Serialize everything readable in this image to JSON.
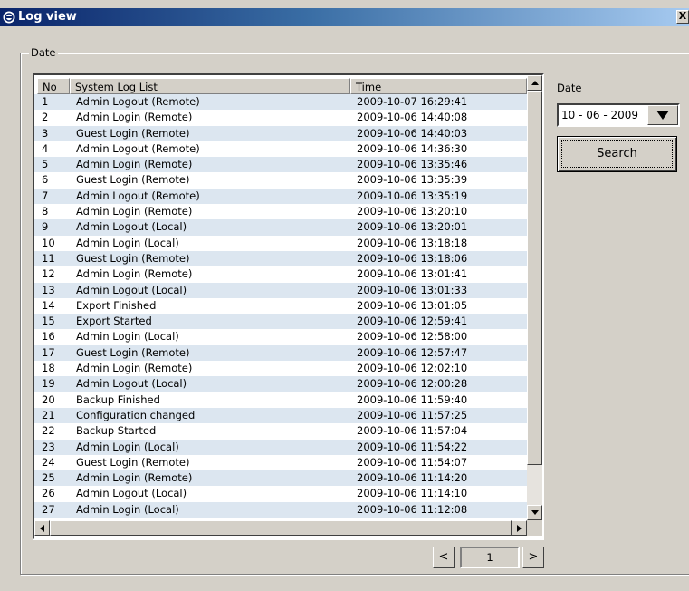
{
  "window": {
    "title": "Log view",
    "close_label": "X"
  },
  "group": {
    "label": "Date"
  },
  "table": {
    "columns": [
      "No",
      "System Log List",
      "Time"
    ],
    "rows": [
      {
        "no": "1",
        "event": "Admin Logout (Remote)",
        "time": "2009-10-07 16:29:41"
      },
      {
        "no": "2",
        "event": "Admin Login (Remote)",
        "time": "2009-10-06 14:40:08"
      },
      {
        "no": "3",
        "event": "Guest Login (Remote)",
        "time": "2009-10-06 14:40:03"
      },
      {
        "no": "4",
        "event": "Admin Logout (Remote)",
        "time": "2009-10-06 14:36:30"
      },
      {
        "no": "5",
        "event": "Admin Login (Remote)",
        "time": "2009-10-06 13:35:46"
      },
      {
        "no": "6",
        "event": "Guest Login (Remote)",
        "time": "2009-10-06 13:35:39"
      },
      {
        "no": "7",
        "event": "Admin Logout (Remote)",
        "time": "2009-10-06 13:35:19"
      },
      {
        "no": "8",
        "event": "Admin Login (Remote)",
        "time": "2009-10-06 13:20:10"
      },
      {
        "no": "9",
        "event": "Admin Logout (Local)",
        "time": "2009-10-06 13:20:01"
      },
      {
        "no": "10",
        "event": "Admin Login (Local)",
        "time": "2009-10-06 13:18:18"
      },
      {
        "no": "11",
        "event": "Guest Login (Remote)",
        "time": "2009-10-06 13:18:06"
      },
      {
        "no": "12",
        "event": "Admin Login (Remote)",
        "time": "2009-10-06 13:01:41"
      },
      {
        "no": "13",
        "event": "Admin Logout (Local)",
        "time": "2009-10-06 13:01:33"
      },
      {
        "no": "14",
        "event": "Export Finished",
        "time": "2009-10-06 13:01:05"
      },
      {
        "no": "15",
        "event": "Export Started",
        "time": "2009-10-06 12:59:41"
      },
      {
        "no": "16",
        "event": "Admin Login (Local)",
        "time": "2009-10-06 12:58:00"
      },
      {
        "no": "17",
        "event": "Guest Login (Remote)",
        "time": "2009-10-06 12:57:47"
      },
      {
        "no": "18",
        "event": "Admin Login (Remote)",
        "time": "2009-10-06 12:02:10"
      },
      {
        "no": "19",
        "event": "Admin Logout (Local)",
        "time": "2009-10-06 12:00:28"
      },
      {
        "no": "20",
        "event": "Backup Finished",
        "time": "2009-10-06 11:59:40"
      },
      {
        "no": "21",
        "event": "Configuration changed",
        "time": "2009-10-06 11:57:25"
      },
      {
        "no": "22",
        "event": "Backup Started",
        "time": "2009-10-06 11:57:04"
      },
      {
        "no": "23",
        "event": "Admin Login (Local)",
        "time": "2009-10-06 11:54:22"
      },
      {
        "no": "24",
        "event": "Guest Login (Remote)",
        "time": "2009-10-06 11:54:07"
      },
      {
        "no": "25",
        "event": "Admin Login (Remote)",
        "time": "2009-10-06 11:14:20"
      },
      {
        "no": "26",
        "event": "Admin Logout (Local)",
        "time": "2009-10-06 11:14:10"
      },
      {
        "no": "27",
        "event": "Admin Login (Local)",
        "time": "2009-10-06 11:12:08"
      }
    ]
  },
  "pagination": {
    "prev_label": "<",
    "page": "1",
    "next_label": ">"
  },
  "sidebar": {
    "date_label": "Date",
    "date_value": "10 - 06 - 2009",
    "search_label": "Search"
  },
  "colors": {
    "title_start": "#0a246a",
    "title_end": "#a6caf0",
    "row_alt": "#dce6f0",
    "window_bg": "#d4d0c8"
  },
  "icons": {
    "app": "app-logo-icon",
    "dropdown": "triangle-down-icon"
  }
}
